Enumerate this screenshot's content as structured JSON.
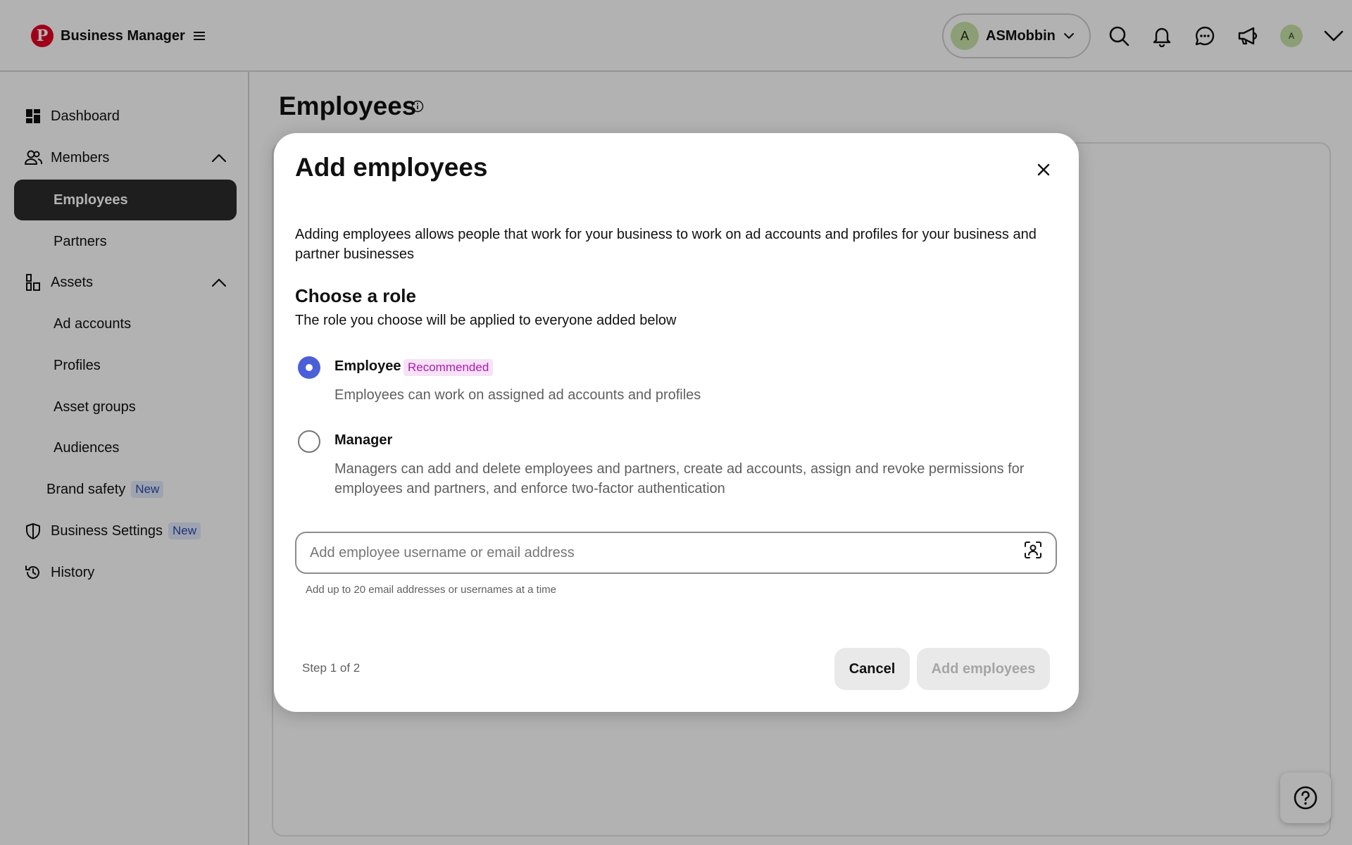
{
  "app": {
    "title": "Business Manager",
    "brand_letter": "P",
    "accent_color": "#e60023"
  },
  "header": {
    "account": {
      "initial": "A",
      "name": "ASMobbin"
    },
    "icons": [
      "search-icon",
      "notifications-bell-icon",
      "messages-icon",
      "announcements-megaphone-icon"
    ],
    "user_initial": "A"
  },
  "sidebar": {
    "items": [
      {
        "label": "Dashboard",
        "icon": "dashboard-icon"
      },
      {
        "label": "Members",
        "icon": "members-icon",
        "expanded": true
      },
      {
        "label": "Employees",
        "active": true
      },
      {
        "label": "Partners"
      },
      {
        "label": "Assets",
        "icon": "assets-icon",
        "expanded": true
      },
      {
        "label": "Ad accounts"
      },
      {
        "label": "Profiles"
      },
      {
        "label": "Asset groups"
      },
      {
        "label": "Audiences"
      },
      {
        "label": "Brand safety",
        "badge": "New"
      },
      {
        "label": "Business Settings",
        "icon": "shield-icon",
        "badge": "New"
      },
      {
        "label": "History",
        "icon": "history-icon"
      }
    ]
  },
  "page": {
    "title": "Employees"
  },
  "modal": {
    "title": "Add employees",
    "description": "Adding employees allows people that work for your business to work on ad accounts and profiles for your business and partner businesses",
    "role_heading": "Choose a role",
    "role_subheading": "The role you choose will be applied to everyone added below",
    "roles": [
      {
        "title": "Employee",
        "badge": "Recommended",
        "description": "Employees can work on assigned ad accounts and profiles",
        "selected": true
      },
      {
        "title": "Manager",
        "description": "Managers can add and delete employees and partners, create ad accounts, assign and revoke permissions for employees and partners, and enforce two-factor authentication",
        "selected": false
      }
    ],
    "input": {
      "value": "",
      "placeholder": "Add employee username or email address",
      "helper": "Add up to 20 email addresses or usernames at a time"
    },
    "step": "Step 1 of 2",
    "cancel_label": "Cancel",
    "submit_label": "Add employees",
    "submit_disabled": true,
    "selected_color": "#4a5fd8",
    "recommended_color": "#b01ab3"
  }
}
